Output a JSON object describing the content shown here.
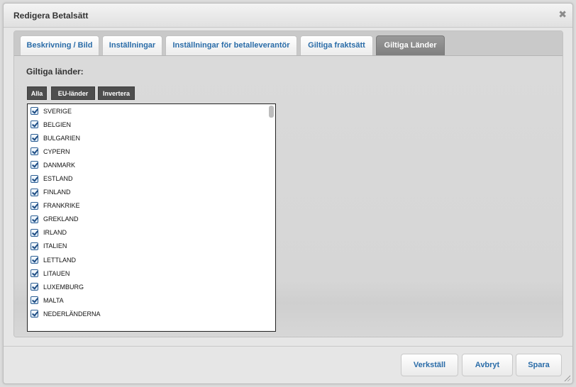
{
  "window": {
    "title": "Redigera Betalsätt",
    "close_symbol": "✖"
  },
  "tabs": [
    {
      "label": "Beskrivning / Bild",
      "active": false
    },
    {
      "label": "Inställningar",
      "active": false
    },
    {
      "label": "Inställningar för betalleverantör",
      "active": false
    },
    {
      "label": "Giltiga fraktsätt",
      "active": false
    },
    {
      "label": "Giltiga Länder",
      "active": true
    }
  ],
  "section": {
    "title": "Giltiga länder:",
    "filter_buttons": {
      "all": "Alla",
      "eu": "EU-länder",
      "invert": "Invertera"
    }
  },
  "countries": [
    {
      "name": "SVERIGE",
      "checked": true
    },
    {
      "name": "BELGIEN",
      "checked": true
    },
    {
      "name": "BULGARIEN",
      "checked": true
    },
    {
      "name": "CYPERN",
      "checked": true
    },
    {
      "name": "DANMARK",
      "checked": true
    },
    {
      "name": "ESTLAND",
      "checked": true
    },
    {
      "name": "FINLAND",
      "checked": true
    },
    {
      "name": "FRANKRIKE",
      "checked": true
    },
    {
      "name": "GREKLAND",
      "checked": true
    },
    {
      "name": "IRLAND",
      "checked": true
    },
    {
      "name": "ITALIEN",
      "checked": true
    },
    {
      "name": "LETTLAND",
      "checked": true
    },
    {
      "name": "LITAUEN",
      "checked": true
    },
    {
      "name": "LUXEMBURG",
      "checked": true
    },
    {
      "name": "MALTA",
      "checked": true
    },
    {
      "name": "NEDERLÄNDERNA",
      "checked": true
    }
  ],
  "footer": {
    "apply": "Verkställ",
    "cancel": "Avbryt",
    "save": "Spara"
  },
  "colors": {
    "link_blue": "#2a6ca8",
    "active_tab": "#8a8a8a",
    "dark_button": "#4e4e4e"
  }
}
